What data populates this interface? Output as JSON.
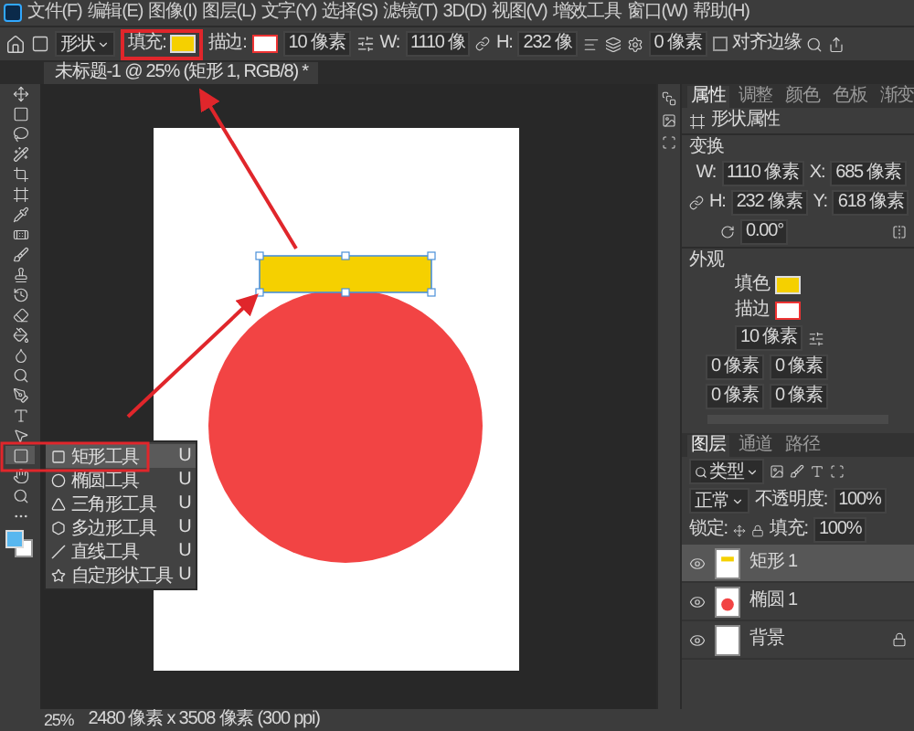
{
  "menu": [
    "文件(F)",
    "编辑(E)",
    "图像(I)",
    "图层(L)",
    "文字(Y)",
    "选择(S)",
    "滤镜(T)",
    "3D(D)",
    "视图(V)",
    "增效工具",
    "窗口(W)",
    "帮助(H)"
  ],
  "options": {
    "tool_mode": "形状",
    "fill_label": "填充:",
    "stroke_label": "描边:",
    "stroke_width": "10 像素",
    "w_label": "W:",
    "w_value": "1110 像",
    "h_label": "H:",
    "h_value": "232 像",
    "radius": "0 像素",
    "align_label": "对齐边缘",
    "align_checked": false
  },
  "document_tab": {
    "title": "未标题-1 @ 25% (矩形 1, RGB/8) *"
  },
  "tools": [
    {
      "kind": "move",
      "selected": false
    },
    {
      "kind": "marquee",
      "selected": false
    },
    {
      "kind": "lasso",
      "selected": false
    },
    {
      "kind": "wand",
      "selected": false
    },
    {
      "kind": "crop",
      "selected": false
    },
    {
      "kind": "frame",
      "selected": false
    },
    {
      "kind": "eyedropper",
      "selected": false
    },
    {
      "kind": "heal",
      "selected": false
    },
    {
      "kind": "brush",
      "selected": false
    },
    {
      "kind": "stamp",
      "selected": false
    },
    {
      "kind": "history",
      "selected": false
    },
    {
      "kind": "eraser",
      "selected": false
    },
    {
      "kind": "gradient",
      "selected": false
    },
    {
      "kind": "blur",
      "selected": false
    },
    {
      "kind": "dodge",
      "selected": false
    },
    {
      "kind": "pen",
      "selected": false
    },
    {
      "kind": "type",
      "selected": false
    },
    {
      "kind": "select",
      "selected": false
    },
    {
      "kind": "shape",
      "selected": true
    },
    {
      "kind": "hand",
      "selected": false
    },
    {
      "kind": "zoom",
      "selected": false
    },
    {
      "kind": "more",
      "selected": false
    }
  ],
  "tool_flyout": [
    {
      "label": "矩形工具",
      "shortcut": "U",
      "kind": "rect",
      "selected": true
    },
    {
      "label": "椭圆工具",
      "shortcut": "U",
      "kind": "ellipse",
      "selected": false
    },
    {
      "label": "三角形工具",
      "shortcut": "U",
      "kind": "triangle",
      "selected": false
    },
    {
      "label": "多边形工具",
      "shortcut": "U",
      "kind": "polygon",
      "selected": false
    },
    {
      "label": "直线工具",
      "shortcut": "U",
      "kind": "line",
      "selected": false
    },
    {
      "label": "自定形状工具",
      "shortcut": "U",
      "kind": "custom",
      "selected": false
    }
  ],
  "canvas": {
    "shapes": [
      {
        "kind": "circle",
        "color": "#f24444"
      },
      {
        "kind": "rect",
        "color": "#f5d000"
      }
    ]
  },
  "properties": {
    "tabs": [
      {
        "label": "属性",
        "selected": true
      },
      {
        "label": "调整",
        "selected": false
      },
      {
        "label": "颜色",
        "selected": false
      },
      {
        "label": "色板",
        "selected": false
      },
      {
        "label": "渐变",
        "selected": false
      }
    ],
    "title": "形状属性",
    "transform": {
      "heading": "变换",
      "w_label": "W:",
      "w": "1110 像素",
      "x_label": "X:",
      "x": "685 像素",
      "h_label": "H:",
      "h": "232 像素",
      "y_label": "Y:",
      "y": "618 像素",
      "angle": "0.00°"
    },
    "appearance": {
      "heading": "外观",
      "fill_label": "填色",
      "stroke_label": "描边",
      "stroke_width": "10 像素",
      "corners": [
        "0 像素",
        "0 像素",
        "0 像素",
        "0 像素"
      ]
    }
  },
  "layers": {
    "tabs": [
      {
        "label": "图层",
        "selected": true
      },
      {
        "label": "通道",
        "selected": false
      },
      {
        "label": "路径",
        "selected": false
      }
    ],
    "filter": "类型",
    "blend": "正常",
    "opacity_label": "不透明度:",
    "opacity": "100%",
    "lock_label": "锁定:",
    "fill_label": "填充:",
    "fill": "100%",
    "items": [
      {
        "name": "矩形 1",
        "kind": "rect",
        "visible": true,
        "selected": true,
        "locked": false
      },
      {
        "name": "椭圆 1",
        "kind": "ellipse",
        "visible": true,
        "selected": false,
        "locked": false
      },
      {
        "name": "背景",
        "kind": "background",
        "visible": true,
        "selected": false,
        "locked": true
      }
    ]
  },
  "status": {
    "zoom": "25%",
    "info": "2480 像素 x 3508 像素 (300 ppi)"
  }
}
